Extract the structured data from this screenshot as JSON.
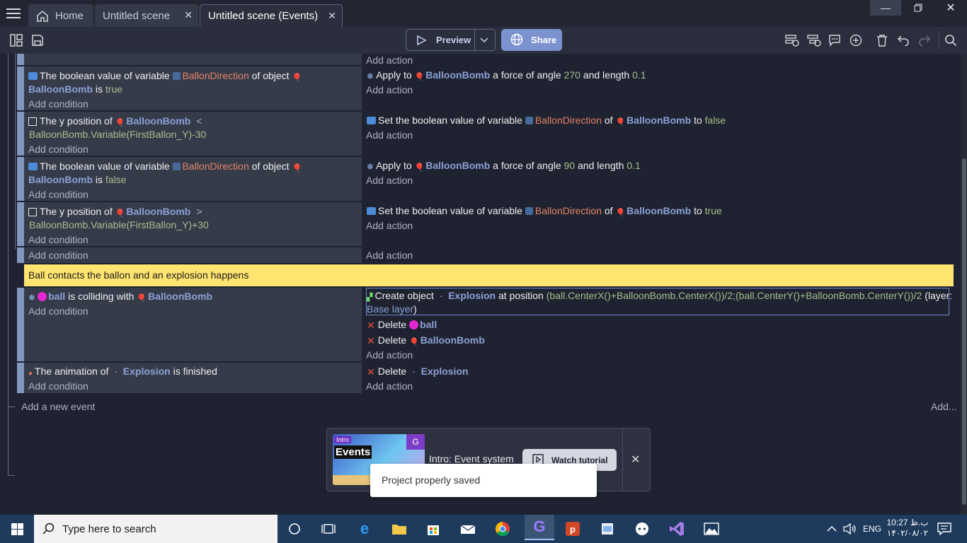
{
  "tabs": [
    {
      "label": "Home"
    },
    {
      "label": "Untitled scene"
    },
    {
      "label": "Untitled scene (Events)"
    }
  ],
  "toolbar": {
    "preview_label": "Preview",
    "share_label": "Share"
  },
  "events": {
    "top_add_action": "Add action",
    "e1": {
      "c1": {
        "a": "The boolean value of variable",
        "var": "BallonDirection",
        "b": "of object",
        "obj": "BalloonBomb",
        "c": "is",
        "val": "true"
      },
      "add_condition": "Add condition",
      "a1": {
        "a": "Apply to",
        "obj": "BalloonBomb",
        "b": "a force of angle",
        "angle": "270",
        "c": "and length",
        "len": "0.1"
      },
      "add_action": "Add action"
    },
    "e2": {
      "c1": {
        "a": "The y position of",
        "obj": "BalloonBomb",
        "op": "<",
        "expr": "BalloonBomb.Variable(FirstBallon_Y)-30"
      },
      "add_condition": "Add condition",
      "a1": {
        "a": "Set the boolean value of variable",
        "var": "BallonDirection",
        "b": "of",
        "obj": "BalloonBomb",
        "c": "to",
        "val": "false"
      },
      "add_action": "Add action"
    },
    "e3": {
      "c1": {
        "a": "The boolean value of variable",
        "var": "BallonDirection",
        "b": "of object",
        "obj": "BalloonBomb",
        "c": "is",
        "val": "false"
      },
      "add_condition": "Add condition",
      "a1": {
        "a": "Apply to",
        "obj": "BalloonBomb",
        "b": "a force of angle",
        "angle": "90",
        "c": "and length",
        "len": "0.1"
      },
      "add_action": "Add action"
    },
    "e4": {
      "c1": {
        "a": "The y position of",
        "obj": "BalloonBomb",
        "op": ">",
        "expr": "BalloonBomb.Variable(FirstBallon_Y)+30"
      },
      "add_condition": "Add condition",
      "a1": {
        "a": "Set the boolean value of variable",
        "var": "BallonDirection",
        "b": "of",
        "obj": "BalloonBomb",
        "c": "to",
        "val": "true"
      },
      "add_action": "Add action"
    },
    "parent_add_condition": "Add condition",
    "parent_add_action": "Add action",
    "comment": "Ball contacts the ballon and an explosion happens",
    "e5": {
      "c1": {
        "obj1": "ball",
        "a": "is colliding with",
        "obj2": "BalloonBomb"
      },
      "add_condition": "Add condition",
      "a1": {
        "a": "Create object",
        "obj": "Explosion",
        "b": "at position",
        "expr": "(ball.CenterX()+BalloonBomb.CenterX())/2;(ball.CenterY()+BalloonBomb.CenterY())/2",
        "c": "(layer:",
        "layer": "Base layer",
        "d": ")"
      },
      "a2": {
        "a": "Delete",
        "obj": "ball"
      },
      "a3": {
        "a": "Delete",
        "obj": "BalloonBomb"
      },
      "add_action": "Add action"
    },
    "e6": {
      "c1": {
        "a": "The animation of",
        "obj": "Explosion",
        "b": "is finished"
      },
      "add_condition": "Add condition",
      "a1": {
        "a": "Delete",
        "obj": "Explosion"
      },
      "add_action": "Add action"
    },
    "add_new_event": "Add a new event",
    "add_more": "Add..."
  },
  "tutorial": {
    "thumb_intro": "Intro",
    "thumb_events": "Events",
    "title": "Intro: Event system",
    "watch_label": "Watch tutorial"
  },
  "toast": "Project properly saved",
  "taskbar": {
    "search_placeholder": "Type here to search",
    "lang": "ENG",
    "time": "10:27 ب.ظ",
    "date": "۱۴۰۲/۰۸/۰۲"
  },
  "colors": {
    "accent": "#8297bd",
    "comment": "#ffe470",
    "share": "#7c92ce",
    "variable": "#e28367",
    "object": "#8aa1d6",
    "value": "#a6bf8d"
  }
}
